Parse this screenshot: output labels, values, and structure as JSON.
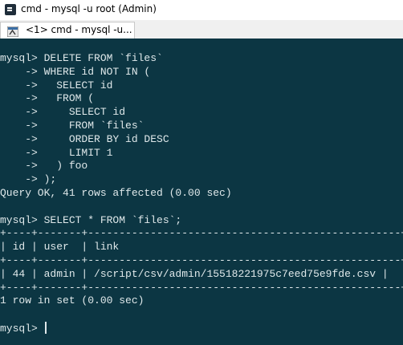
{
  "window": {
    "title": "cmd - mysql  -u root (Admin)",
    "icon": "console-icon"
  },
  "tab": {
    "label": "<1> cmd - mysql  -u...",
    "icon": "cmder-lambda-icon"
  },
  "terminal": {
    "background": "#0c3643",
    "foreground": "#dfe8ea",
    "lines": [
      "mysql> DELETE FROM `files`",
      "    -> WHERE id NOT IN (",
      "    ->   SELECT id",
      "    ->   FROM (",
      "    ->     SELECT id",
      "    ->     FROM `files`",
      "    ->     ORDER BY id DESC",
      "    ->     LIMIT 1",
      "    ->   ) foo",
      "    -> );",
      "Query OK, 41 rows affected (0.00 sec)",
      "",
      "mysql> SELECT * FROM `files`;",
      "+----+-------+--------------------------------------------------+",
      "| id | user  | link                                             |",
      "+----+-------+--------------------------------------------------+",
      "| 44 | admin | /script/csv/admin/15518221975c7eed75e9fde.csv |",
      "+----+-------+--------------------------------------------------+",
      "1 row in set (0.00 sec)",
      "",
      "mysql> "
    ]
  }
}
